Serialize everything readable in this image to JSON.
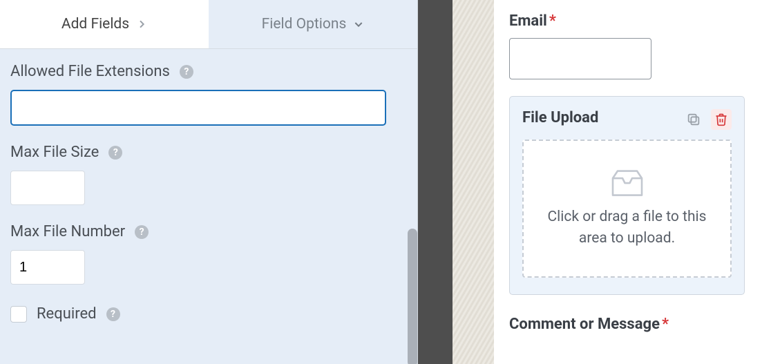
{
  "tabs": {
    "add_fields": "Add Fields",
    "field_options": "Field Options"
  },
  "options": {
    "allowed_ext": {
      "label": "Allowed File Extensions",
      "value": ""
    },
    "max_size": {
      "label": "Max File Size",
      "value": ""
    },
    "max_number": {
      "label": "Max File Number",
      "value": "1"
    },
    "required": {
      "label": "Required"
    }
  },
  "preview": {
    "email_label": "Email",
    "upload_title": "File Upload",
    "dropzone_text": "Click or drag a file to this area to upload.",
    "comment_label": "Comment or Message"
  }
}
